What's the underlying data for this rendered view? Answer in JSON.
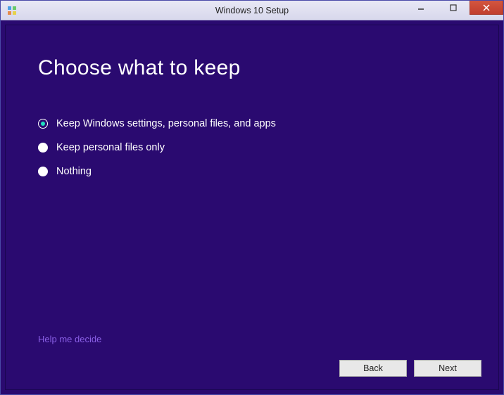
{
  "window": {
    "title": "Windows 10 Setup"
  },
  "page": {
    "heading": "Choose what to keep"
  },
  "options": [
    {
      "label": "Keep Windows settings, personal files, and apps",
      "selected": true
    },
    {
      "label": "Keep personal files only",
      "selected": false
    },
    {
      "label": "Nothing",
      "selected": false
    }
  ],
  "help_link": "Help me decide",
  "buttons": {
    "back": "Back",
    "next": "Next"
  }
}
